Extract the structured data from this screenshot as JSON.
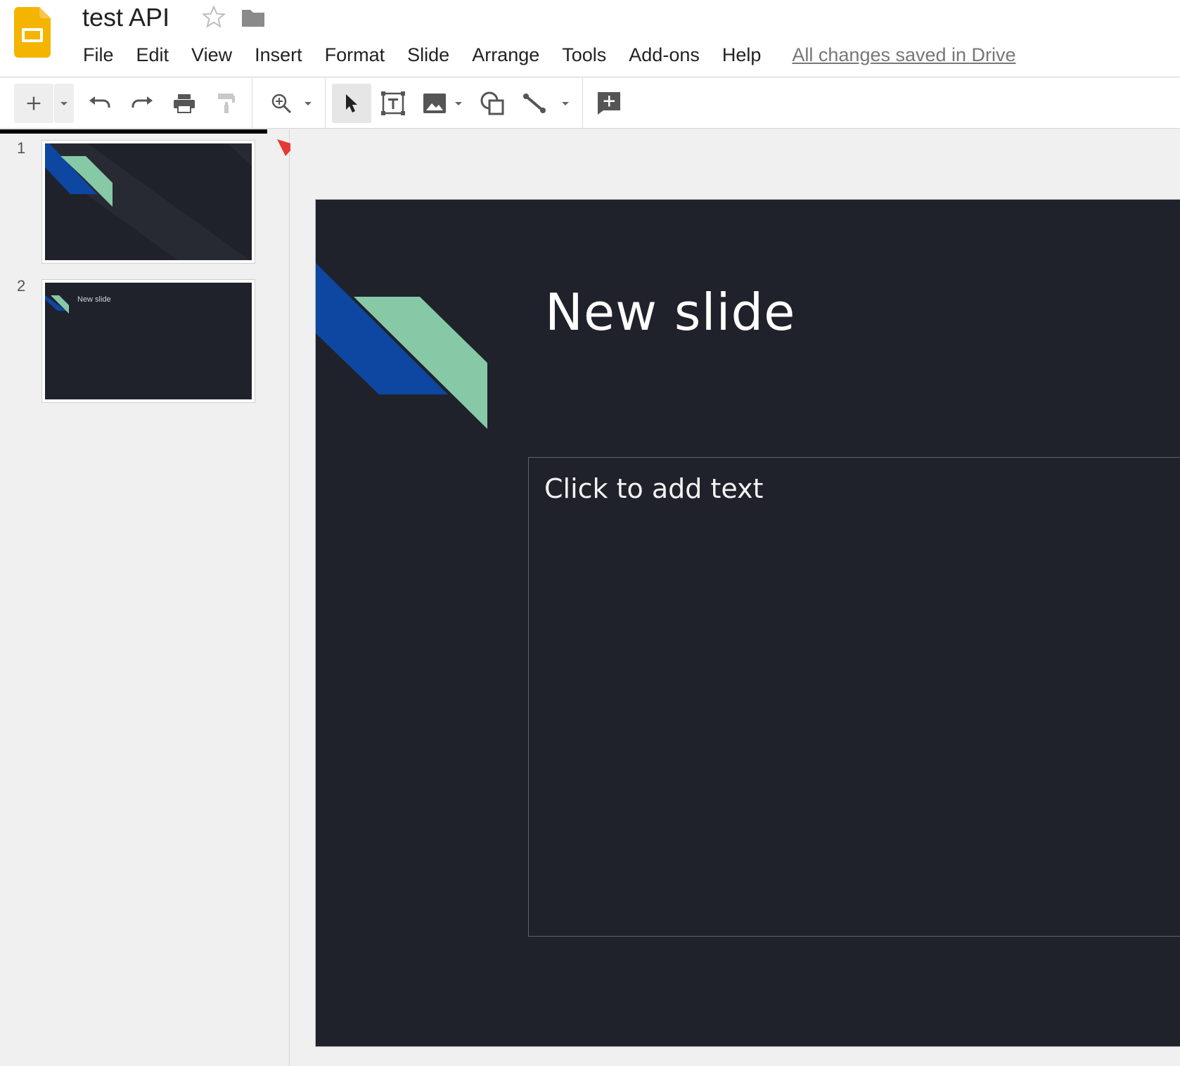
{
  "app": {
    "title": "test API",
    "save_status": "All changes saved in Drive",
    "accent": "#f4b400"
  },
  "menu": [
    "File",
    "Edit",
    "View",
    "Insert",
    "Format",
    "Slide",
    "Arrange",
    "Tools",
    "Add-ons",
    "Help"
  ],
  "toolbar": {
    "icons": [
      "new-slide",
      "dropdown",
      "undo",
      "redo",
      "print",
      "paint-format",
      "zoom",
      "dropdown",
      "select",
      "text-box",
      "image",
      "dropdown",
      "shape",
      "line",
      "dropdown",
      "comment"
    ]
  },
  "filmstrip": {
    "slides": [
      {
        "number": "1",
        "label": ""
      },
      {
        "number": "2",
        "label": "New slide"
      }
    ]
  },
  "slide": {
    "title": "New slide",
    "body_placeholder": "Click to add text",
    "background": "#1f222b",
    "shape_blue": "#0d47a1",
    "shape_green": "#87c9a7"
  },
  "annotation": {
    "arrow_color": "#e53935"
  }
}
